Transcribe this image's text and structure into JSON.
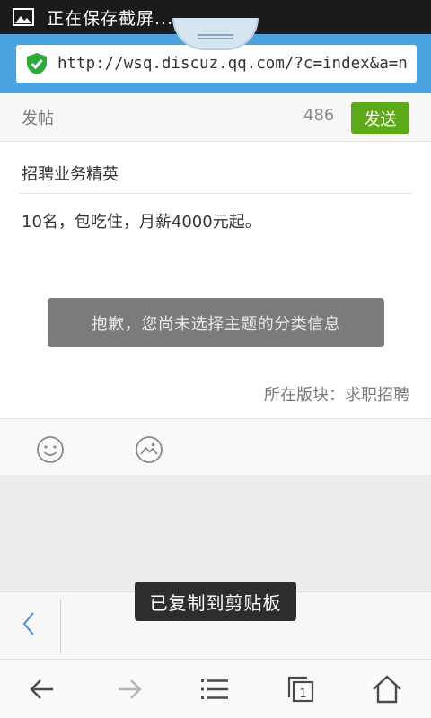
{
  "status_bar": {
    "text": "正在保存截屏...",
    "icon": "image-icon"
  },
  "url_bar": {
    "url": "http://wsq.discuz.qq.com/?c=index&a=n",
    "icon": "shield-check-icon"
  },
  "post_header": {
    "title": "发帖",
    "char_count": "486",
    "send_label": "发送"
  },
  "post": {
    "subject": "招聘业务精英",
    "content": "10名，包吃住，月薪4000元起。"
  },
  "error_toast": "抱歉，您尚未选择主题的分类信息",
  "board_label": "所在版块：求职招聘",
  "toolbar": {
    "items": [
      "smiley-icon",
      "image-insert-icon"
    ]
  },
  "reply_bar": {
    "icon": "chevron-left-icon"
  },
  "copy_toast": "已复制到剪贴板",
  "nav": {
    "items": [
      "back-arrow-icon",
      "forward-arrow-icon",
      "menu-icon",
      "tabs-icon",
      "home-icon"
    ],
    "tab_count": "1"
  },
  "colors": {
    "accent_blue": "#4aa3df",
    "send_green": "#5da917",
    "status_bar": "#1b1b1b"
  }
}
